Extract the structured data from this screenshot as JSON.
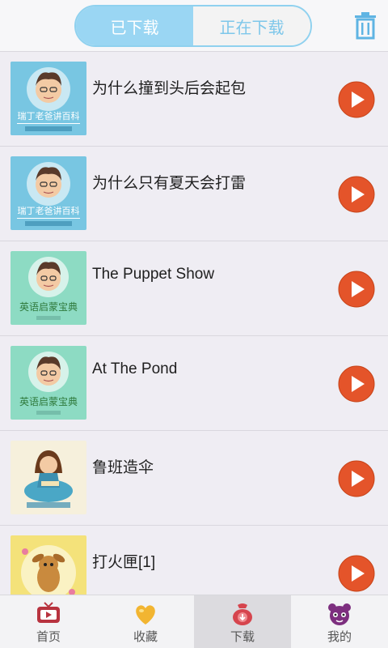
{
  "header": {
    "tabs": [
      {
        "label": "已下载",
        "active": true
      },
      {
        "label": "正在下载",
        "active": false
      }
    ],
    "trash_icon": "trash-icon"
  },
  "items": [
    {
      "title": "为什么撞到头后会起包",
      "thumb": "ruiding-baike",
      "thumb_text": "瑞丁老爸讲百科"
    },
    {
      "title": "为什么只有夏天会打雷",
      "thumb": "ruiding-baike",
      "thumb_text": "瑞丁老爸讲百科"
    },
    {
      "title": "The Puppet Show",
      "thumb": "english",
      "thumb_text": "英语启蒙宝典"
    },
    {
      "title": "At The Pond",
      "thumb": "english",
      "thumb_text": "英语启蒙宝典"
    },
    {
      "title": "鲁班造伞",
      "thumb": "story-girl",
      "thumb_text": ""
    },
    {
      "title": "打火匣[1]",
      "thumb": "deer",
      "thumb_text": ""
    }
  ],
  "nav": [
    {
      "label": "首页",
      "icon": "tv-icon",
      "active": false
    },
    {
      "label": "收藏",
      "icon": "heart-icon",
      "active": false
    },
    {
      "label": "下载",
      "icon": "download-bag-icon",
      "active": true
    },
    {
      "label": "我的",
      "icon": "bear-face-icon",
      "active": false
    }
  ],
  "colors": {
    "accent": "#9ad6f3",
    "play": "#e4542a",
    "background": "#efedf3"
  }
}
